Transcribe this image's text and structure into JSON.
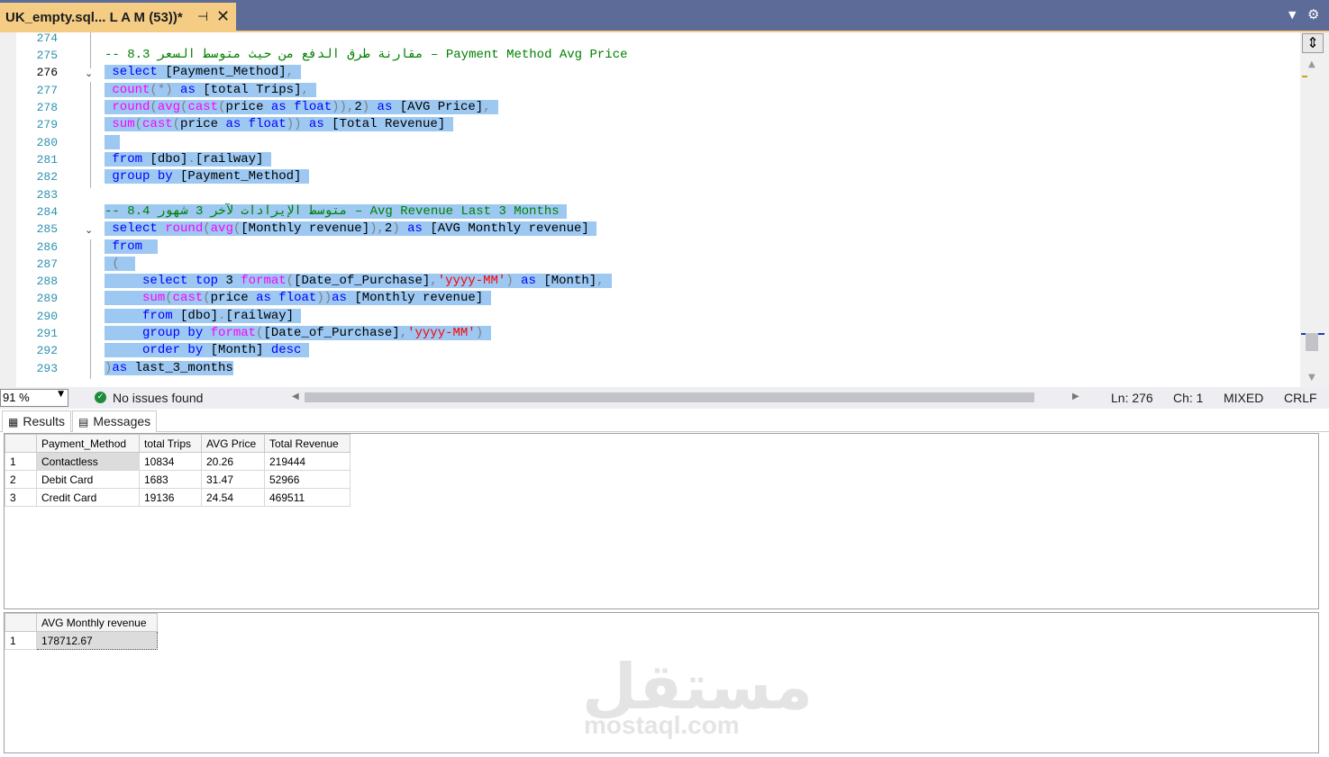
{
  "tab": {
    "title": "UK_empty.sql... L A M (53))*",
    "pin_icon": "pin-icon",
    "close_icon": "close-icon"
  },
  "editor": {
    "line_numbers": [
      "274",
      "275",
      "276",
      "277",
      "278",
      "279",
      "280",
      "281",
      "282",
      "283",
      "284",
      "285",
      "286",
      "287",
      "288",
      "289",
      "290",
      "291",
      "292",
      "293"
    ],
    "current_line": "276"
  },
  "code": {
    "l275": {
      "a": "-- 8.3 ",
      "b": "مقارنة طرق الدفع من حيث متوسط السعر",
      "c": " – Payment Method Avg Price"
    },
    "l276": {
      "a": "select",
      "b": " [Payment_Method]",
      "c": ","
    },
    "l277": {
      "a": "count",
      "b": "(*)",
      "c": " as",
      "d": " [total Trips]",
      "e": ","
    },
    "l278": {
      "a": "round",
      "b": "(",
      "c": "avg",
      "d": "(",
      "e": "cast",
      "f": "(",
      "g": "price",
      "h": " as",
      "i": " float",
      "j": ")),",
      "k": "2",
      "l": ")",
      "m": " as",
      "n": " [AVG Price]",
      "o": ","
    },
    "l279": {
      "a": "sum",
      "b": "(",
      "c": "cast",
      "d": "(",
      "e": "price",
      "f": " as",
      "g": " float",
      "h": "))",
      "i": " as",
      "j": " [Total Revenue]"
    },
    "l281": {
      "a": "from",
      "b": " [dbo]",
      "c": ".",
      "d": "[railway]"
    },
    "l282": {
      "a": "group by",
      "b": " [Payment_Method]"
    },
    "l284": {
      "a": "-- 8.4 ",
      "b": "متوسط الإيرادات لآخر 3 شهور",
      "c": " – Avg Revenue Last 3 Months"
    },
    "l285": {
      "a": "select",
      "b": " round",
      "c": "(",
      "d": "avg",
      "e": "(",
      "f": "[Monthly revenue]",
      "g": "),",
      "h": "2",
      "i": ")",
      "j": " as",
      "k": " [AVG Monthly revenue]"
    },
    "l286": {
      "a": "from"
    },
    "l287": {
      "a": "("
    },
    "l288": {
      "a": "select top",
      "b": " 3",
      "c": " format",
      "d": "(",
      "e": "[Date_of_Purchase]",
      "f": ",",
      "g": "'yyyy-MM'",
      "h": ")",
      "i": " as",
      "j": " [Month]",
      "k": ","
    },
    "l289": {
      "a": "sum",
      "b": "(",
      "c": "cast",
      "d": "(",
      "e": "price",
      "f": " as",
      "g": " float",
      "h": "))",
      "i": "as",
      "j": " [Monthly revenue]"
    },
    "l290": {
      "a": "from",
      "b": " [dbo]",
      "c": ".",
      "d": "[railway]"
    },
    "l291": {
      "a": "group by",
      "b": " format",
      "c": "(",
      "d": "[Date_of_Purchase]",
      "e": ",",
      "f": "'yyyy-MM'",
      "g": ")"
    },
    "l292": {
      "a": "order by",
      "b": " [Month]",
      "c": " desc"
    },
    "l293": {
      "a": ")",
      "b": "as",
      "c": " last_3_months"
    }
  },
  "status": {
    "zoom": "91 %",
    "issues": "No issues found",
    "ln": "Ln: 276",
    "ch": "Ch: 1",
    "mixed": "MIXED",
    "crlf": "CRLF"
  },
  "results_tabs": {
    "results": "Results",
    "messages": "Messages"
  },
  "grid1": {
    "columns": [
      "Payment_Method",
      "total Trips",
      "AVG Price",
      "Total Revenue"
    ],
    "rows": [
      {
        "n": "1",
        "cells": [
          "Contactless",
          "10834",
          "20.26",
          "219444"
        ]
      },
      {
        "n": "2",
        "cells": [
          "Debit Card",
          "1683",
          "31.47",
          "52966"
        ]
      },
      {
        "n": "3",
        "cells": [
          "Credit Card",
          "19136",
          "24.54",
          "469511"
        ]
      }
    ]
  },
  "grid2": {
    "columns": [
      "AVG Monthly revenue"
    ],
    "rows": [
      {
        "n": "1",
        "cells": [
          "178712.67"
        ]
      }
    ]
  },
  "watermark": {
    "arabic": "مستقل",
    "latin": "mostaql.com"
  }
}
